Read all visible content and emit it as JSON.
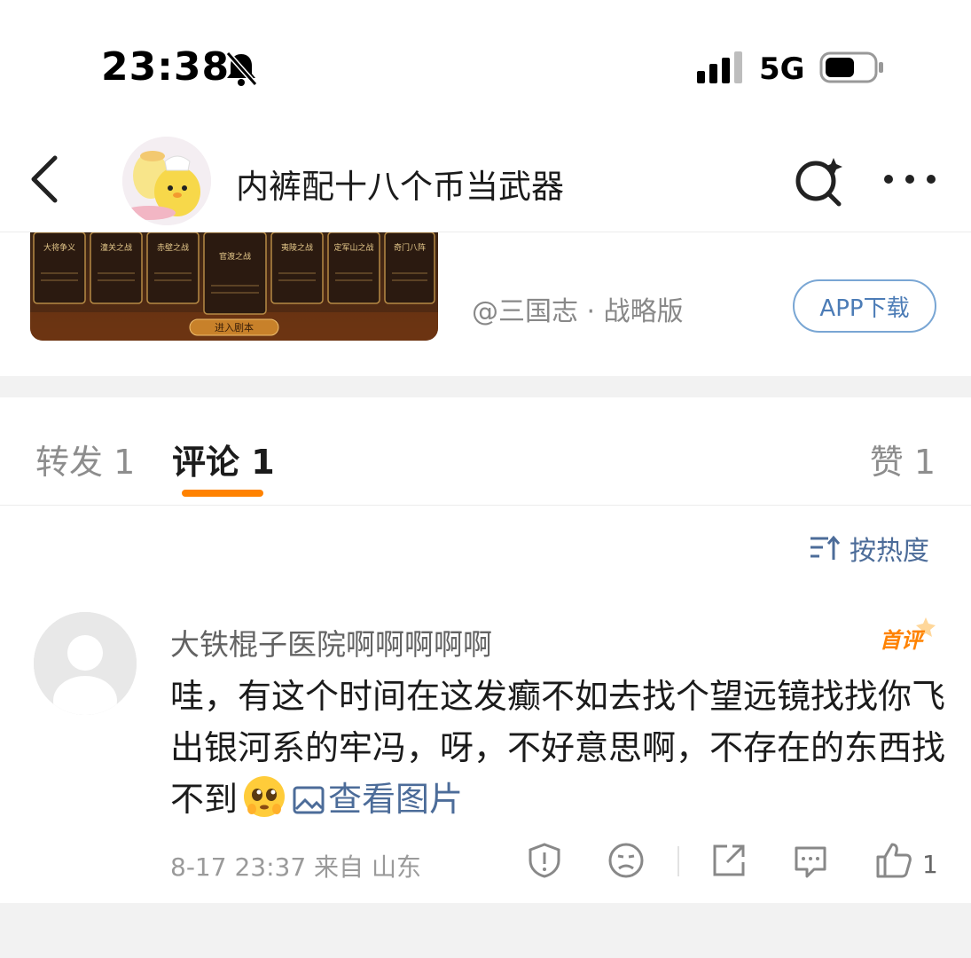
{
  "status_bar": {
    "time": "23:38",
    "network": "5G",
    "icons": [
      "bell-muted-icon",
      "signal-icon",
      "battery-icon"
    ]
  },
  "header": {
    "title": "内裤配十八个币当武器",
    "icons": [
      "back-icon",
      "avatar",
      "search-sparkle-icon",
      "more-icon"
    ]
  },
  "promo": {
    "card_labels": [
      "大将争义",
      "潼关之战",
      "赤壁之战",
      "官渡之战",
      "夷陵之战",
      "定军山之战",
      "奇门八阵"
    ],
    "enter_button": "进入剧本",
    "source": "@三国志 · 战略版",
    "app_button": "APP下载"
  },
  "tabs": [
    {
      "label": "转发 1"
    },
    {
      "label": "评论 1"
    },
    {
      "label": "赞 1"
    }
  ],
  "sort": {
    "label": "按热度"
  },
  "comment": {
    "author": "大铁棍子医院啊啊啊啊啊",
    "badge": "首评",
    "text": "哇，有这个时间在这发癫不如去找个望远镜找找你飞出银河系的牢冯，呀，不好意思啊，不存在的东西找不到",
    "image_link": "查看图片",
    "meta": "8-17 23:37 来自 山东",
    "likes": "1"
  },
  "colors": {
    "accent": "#ff8200",
    "link": "#4c6c99",
    "app_button_border": "#79a6d4"
  }
}
